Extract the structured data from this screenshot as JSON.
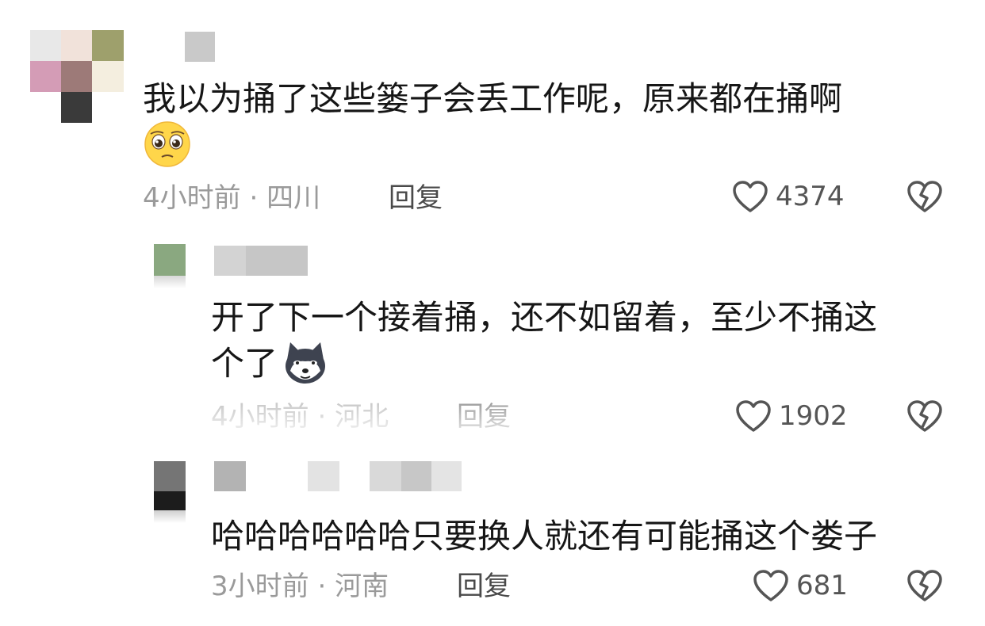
{
  "comments": [
    {
      "text": "我以为捅了这些篓子会丢工作呢，原来都在捅啊",
      "time": "4小时前",
      "location": "四川",
      "reply_label": "回复",
      "likes": "4374",
      "emoji": "pleading-face"
    },
    {
      "text_line1": "开了下一个接着捅，还不如留着，至少不捅这",
      "text_line2": "个了",
      "time": "4小时前",
      "location": "河北",
      "reply_label": "回复",
      "likes": "1902",
      "emoji": "husky-dog-face"
    },
    {
      "text": "哈哈哈哈哈哈只要换人就还有可能捅这个娄子",
      "time": "3小时前",
      "location": "河南",
      "reply_label": "回复",
      "likes": "681"
    }
  ],
  "meta_separator": "·",
  "icons": {
    "like": "heart-outline-icon",
    "dislike": "broken-heart-icon"
  },
  "colors": {
    "text": "#161616",
    "meta": "#9a9a9a",
    "reply": "#4a4a4a"
  }
}
